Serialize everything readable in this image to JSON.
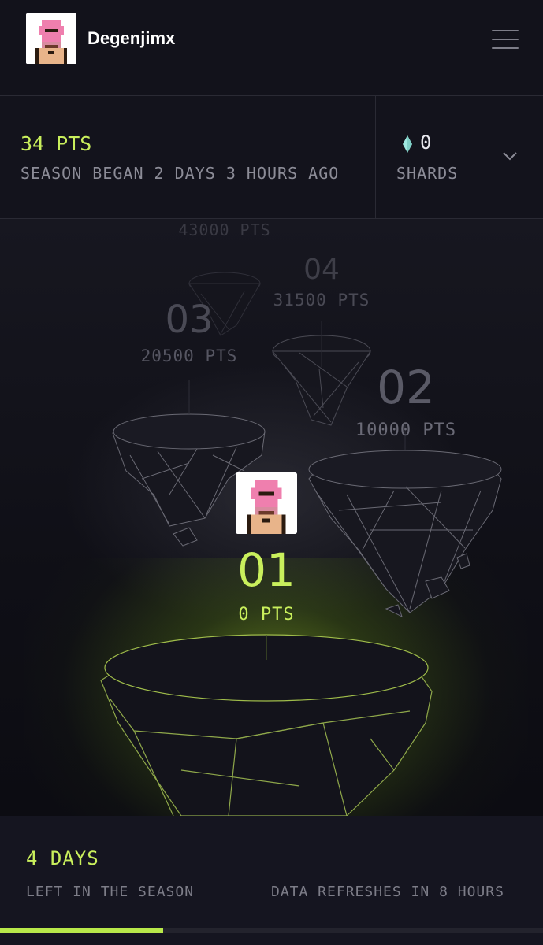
{
  "header": {
    "username": "Degenjimx",
    "avatar_icon": "pixel-ape-avatar-icon",
    "menu_icon": "hamburger-menu-icon"
  },
  "stats": {
    "points": "34 PTS",
    "season_started": "SEASON BEGAN 2 DAYS 3 HOURS AGO",
    "shards_count": "0",
    "shards_label": "SHARDS",
    "shard_icon": "diamond-icon",
    "expand_icon": "chevron-down-icon"
  },
  "levels": [
    {
      "number": "01",
      "points": "0 PTS",
      "current": true
    },
    {
      "number": "02",
      "points": "10000 PTS"
    },
    {
      "number": "03",
      "points": "20500 PTS"
    },
    {
      "number": "04",
      "points": "31500 PTS"
    },
    {
      "number": "",
      "points": "43000 PTS"
    }
  ],
  "footer": {
    "days_left": "4 DAYS",
    "days_left_label": "LEFT IN THE SEASON",
    "refresh_label": "DATA REFRESHES IN 8 HOURS",
    "season_progress_percent": 30
  },
  "colors": {
    "accent": "#c9ef5c",
    "background": "#12121b",
    "shard": "#9fe8e0"
  }
}
